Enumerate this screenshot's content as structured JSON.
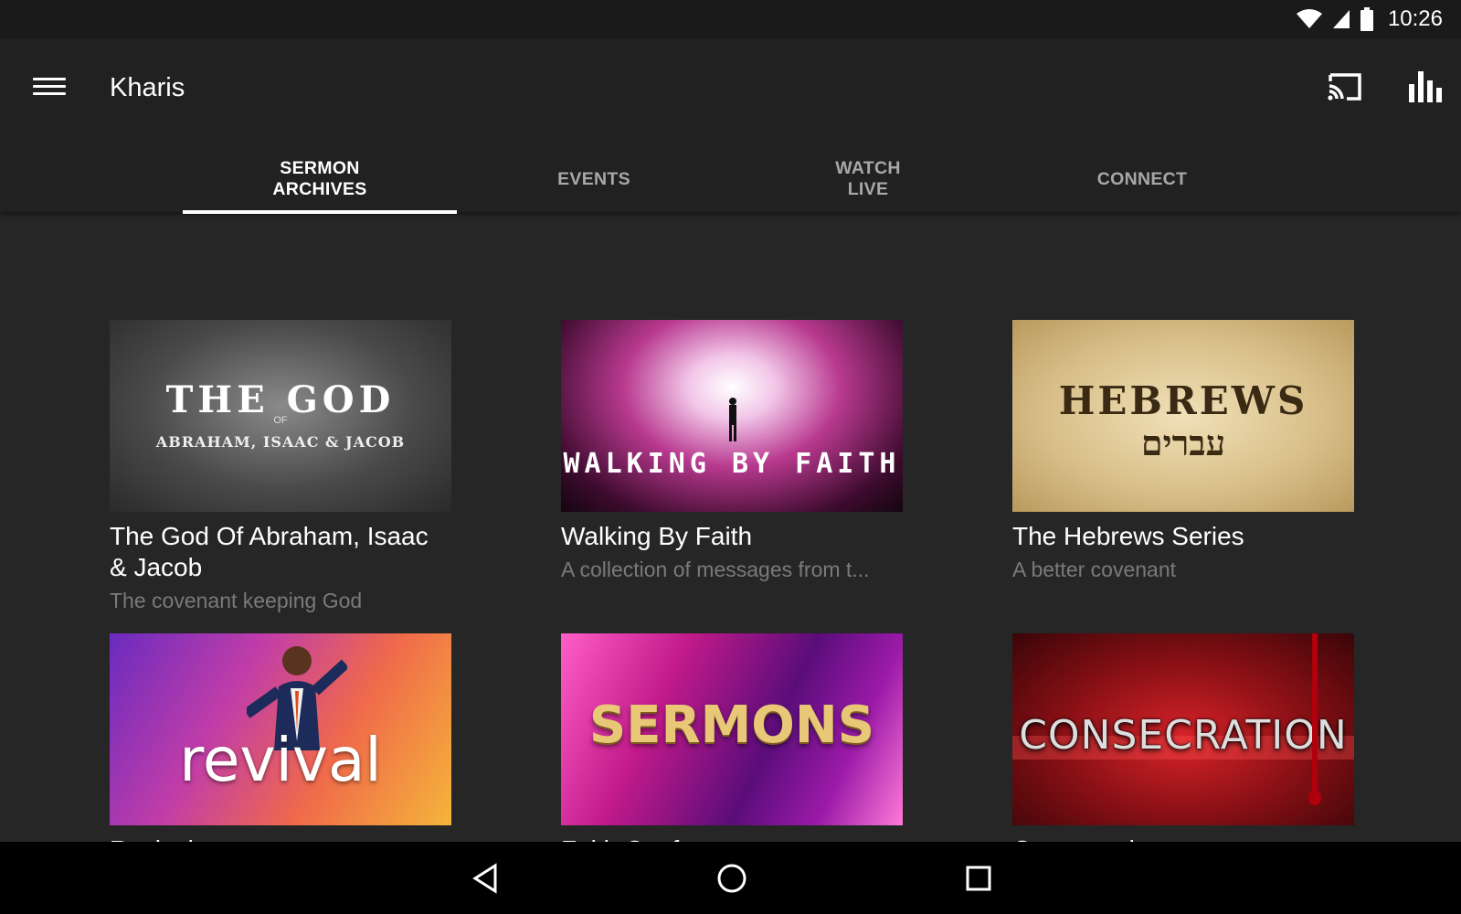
{
  "status_bar": {
    "time": "10:26"
  },
  "app_bar": {
    "title": "Kharis"
  },
  "tabs": [
    {
      "label": "SERMON\nARCHIVES",
      "active": true
    },
    {
      "label": "EVENTS",
      "active": false
    },
    {
      "label": "WATCH\nLIVE",
      "active": false
    },
    {
      "label": "CONNECT",
      "active": false
    }
  ],
  "series": [
    {
      "title": "The God Of Abraham, Isaac & Jacob",
      "subtitle": "The covenant keeping God",
      "art": {
        "line1": "THE GOD",
        "line2": "OF",
        "line3": "ABRAHAM, ISAAC & JACOB"
      }
    },
    {
      "title": "Walking By Faith",
      "subtitle": "A collection of messages from t...",
      "art": {
        "line1": "WALKING BY FAITH"
      }
    },
    {
      "title": "The Hebrews Series",
      "subtitle": "A better covenant",
      "art": {
        "line1": "HEBREWS",
        "line2": "עברים"
      }
    },
    {
      "title": "Revival",
      "subtitle": "",
      "art": {
        "line1": "revival"
      }
    },
    {
      "title": "Faith Conference",
      "subtitle": "",
      "art": {
        "line1": "SERMONS"
      }
    },
    {
      "title": "Consecration",
      "subtitle": "",
      "art": {
        "line1": "CONSECRATION"
      }
    }
  ],
  "icons": {
    "menu": "hamburger-menu-icon",
    "cast": "cast-icon",
    "equalizer": "equalizer-icon",
    "wifi": "wifi-icon",
    "signal": "cell-signal-icon",
    "battery": "battery-icon",
    "back": "back-triangle-icon",
    "home": "home-circle-icon",
    "recents": "recents-square-icon"
  },
  "colors": {
    "background": "#262626",
    "app_bar": "#212121",
    "tab_indicator": "#ffffff"
  }
}
